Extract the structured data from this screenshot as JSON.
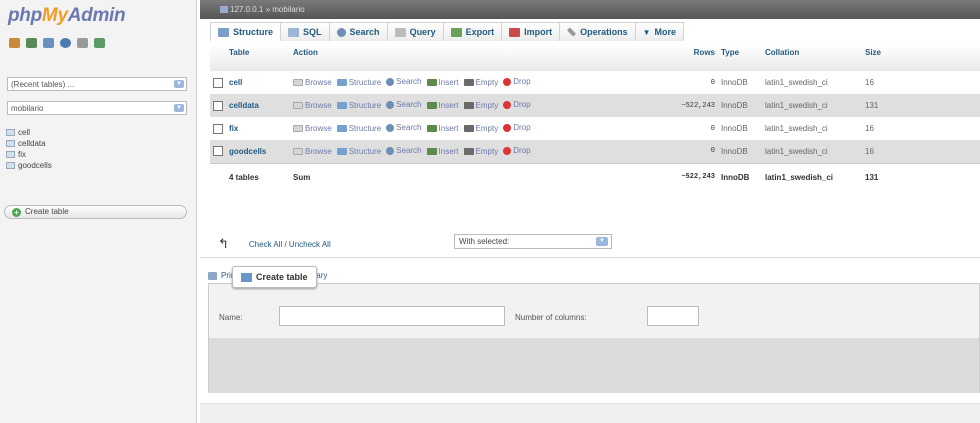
{
  "nav": {
    "logo": {
      "php": "php",
      "my": "My",
      "admin": "Admin"
    },
    "icons": [
      "home-icon",
      "database-icon",
      "query-icon",
      "docs-icon",
      "settings-icon",
      "reload-icon"
    ],
    "recent_tables": "(Recent tables) ...",
    "database": "mobilario",
    "tables": [
      "cell",
      "celldata",
      "fix",
      "goodcells"
    ],
    "create_table": "Create table"
  },
  "main": {
    "breadcrumb": "127.0.0.1 » mobilario",
    "tabs": [
      {
        "label": "Structure",
        "icon": "structure-icon"
      },
      {
        "label": "SQL",
        "icon": "sql-icon"
      },
      {
        "label": "Search",
        "icon": "search-icon"
      },
      {
        "label": "Query",
        "icon": "query-icon"
      },
      {
        "label": "Export",
        "icon": "export-icon"
      },
      {
        "label": "Import",
        "icon": "import-icon"
      },
      {
        "label": "Operations",
        "icon": "wrench-icon"
      },
      {
        "label": "More",
        "icon": "chevron-down-icon"
      }
    ],
    "table_headers": {
      "table": "Table",
      "action": "Action",
      "rows": "Rows",
      "type": "Type",
      "collation": "Collation",
      "size": "Size"
    },
    "actions": {
      "browse": "Browse",
      "structure": "Structure",
      "search": "Search",
      "insert": "Insert",
      "empty": "Empty",
      "drop": "Drop"
    },
    "rows": [
      {
        "name": "cell",
        "rows": "0",
        "type": "InnoDB",
        "collation": "latin1_swedish_ci",
        "size": "16"
      },
      {
        "name": "celldata",
        "rows": "~522,243",
        "type": "InnoDB",
        "collation": "latin1_swedish_ci",
        "size": "131"
      },
      {
        "name": "fix",
        "rows": "0",
        "type": "InnoDB",
        "collation": "latin1_swedish_ci",
        "size": "16"
      },
      {
        "name": "goodcells",
        "rows": "0",
        "type": "InnoDB",
        "collation": "latin1_swedish_ci",
        "size": "16"
      }
    ],
    "footer": {
      "count": "4 tables",
      "sum": "Sum",
      "rows": "~522,243",
      "type": "InnoDB",
      "collation": "latin1_swedish_ci",
      "size": "131"
    },
    "check_all": "Check All / Uncheck All",
    "with_selected": "With selected:",
    "print_view": "Print view",
    "data_dictionary": "Data Dictionary",
    "create_table": {
      "legend": "Create table",
      "name_label": "Name:",
      "columns_label": "Number of columns:"
    }
  }
}
